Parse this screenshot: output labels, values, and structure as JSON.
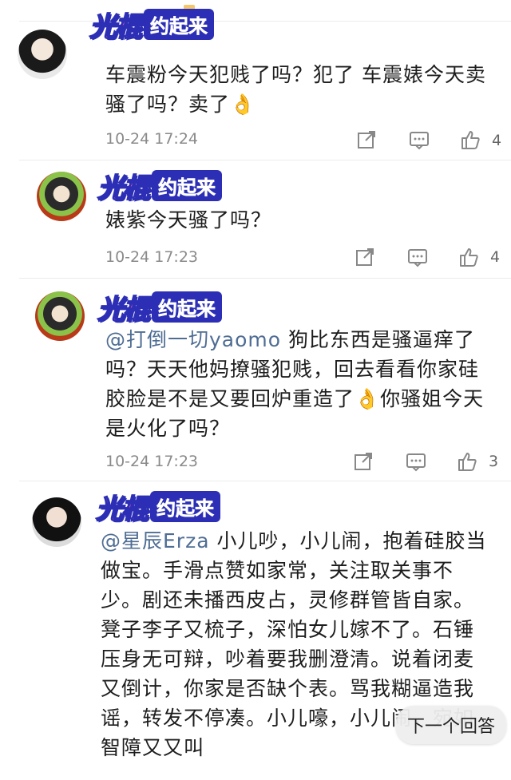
{
  "watermark": {
    "part_a": "光棍",
    "part_b": "约起来"
  },
  "next_button": "下一个回答",
  "comments": [
    {
      "text": "车震粉今天犯贱了吗？犯了 车震婊今天卖骚了吗？卖了",
      "emoji": "👌",
      "time": "10-24 17:24",
      "likes": "4"
    },
    {
      "text": "婊紫今天骚了吗？",
      "time": "10-24 17:23",
      "likes": "4"
    },
    {
      "mention": "@打倒一切yaomo",
      "text": " 狗比东西是骚逼痒了吗？天天他妈撩骚犯贱，回去看看你家硅胶脸是不是又要回炉重造了",
      "emoji": "👌",
      "text2": "你骚姐今天是火化了吗？",
      "time": "10-24 17:23",
      "likes": "3"
    },
    {
      "mention": "@星辰Erza",
      "text": " 小儿吵，小儿闹，抱着硅胶当做宝。手滑点赞如家常，关注取关事不少。剧还未播西皮占，灵修群管皆自家。凳子李子又梳子，深怕女儿嫁不了。石锤压身无可辩，吵着要我删澄清。说着闭麦又倒计，你家是否缺个表。骂我糊逼造我谣，转发不停凑。小儿嚎，小儿闹，宛如智障又又叫"
    }
  ]
}
